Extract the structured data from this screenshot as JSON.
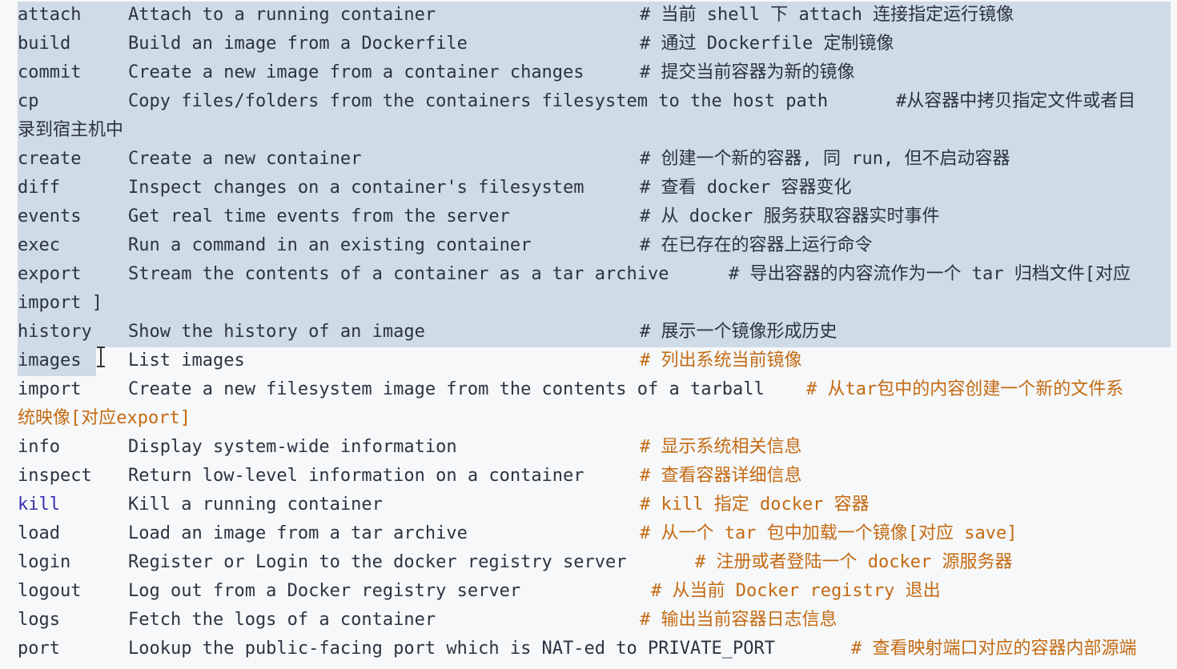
{
  "selection_color": "#cfdbe6",
  "comment_orange": "#c46a12",
  "lines": [
    {
      "cmd": "attach",
      "desc": "Attach to a running container",
      "comment": "# 当前 shell 下 attach 连接指定运行镜像"
    },
    {
      "cmd": "build",
      "desc": "Build an image from a Dockerfile",
      "comment": "# 通过 Dockerfile 定制镜像"
    },
    {
      "cmd": "commit",
      "desc": "Create a new image from a container changes",
      "comment": "# 提交当前容器为新的镜像"
    },
    {
      "cmd": "cp",
      "desc": "Copy files/folders from the containers filesystem to the host path",
      "comment": "#从容器中拷贝指定文件或者目",
      "continuation": "录到宿主机中"
    },
    {
      "cmd": "create",
      "desc": "Create a new container",
      "comment": "# 创建一个新的容器, 同 run, 但不启动容器"
    },
    {
      "cmd": "diff",
      "desc": "Inspect changes on a container's filesystem",
      "comment": "# 查看 docker 容器变化"
    },
    {
      "cmd": "events",
      "desc": "Get real time events from the server",
      "comment": "# 从 docker 服务获取容器实时事件"
    },
    {
      "cmd": "exec",
      "desc": "Run a command in an existing container",
      "comment": "# 在已存在的容器上运行命令"
    },
    {
      "cmd": "export",
      "desc": "Stream the contents of a container as a tar archive",
      "comment": "# 导出容器的内容流作为一个 tar 归档文件[对应",
      "continuation": "import ]"
    },
    {
      "cmd": "history",
      "desc": "Show the history of an image",
      "comment": "# 展示一个镜像形成历史"
    },
    {
      "cmd": "images",
      "desc": "List images",
      "comment": "# 列出系统当前镜像"
    },
    {
      "cmd": "import",
      "desc": "Create a new filesystem image from the contents of a tarball",
      "comment": "# 从tar包中的内容创建一个新的文件系",
      "continuation": "统映像[对应export]"
    },
    {
      "cmd": "info",
      "desc": "Display system-wide information",
      "comment": "# 显示系统相关信息"
    },
    {
      "cmd": "inspect",
      "desc": "Return low-level information on a container",
      "comment": "# 查看容器详细信息"
    },
    {
      "cmd": "kill",
      "desc": "Kill a running container",
      "comment": "# kill 指定 docker 容器"
    },
    {
      "cmd": "load",
      "desc": "Load an image from a tar archive",
      "comment": "# 从一个 tar 包中加载一个镜像[对应 save]"
    },
    {
      "cmd": "login",
      "desc": "Register or Login to the docker registry server",
      "comment": "# 注册或者登陆一个 docker 源服务器"
    },
    {
      "cmd": "logout",
      "desc": "Log out from a Docker registry server",
      "comment": "# 从当前 Docker registry 退出"
    },
    {
      "cmd": "logs",
      "desc": "Fetch the logs of a container",
      "comment": "# 输出当前容器日志信息"
    },
    {
      "cmd": "port",
      "desc": "Lookup the public-facing port which is NAT-ed to PRIVATE_PORT",
      "comment": "# 查看映射端口对应的容器内部源端"
    }
  ]
}
